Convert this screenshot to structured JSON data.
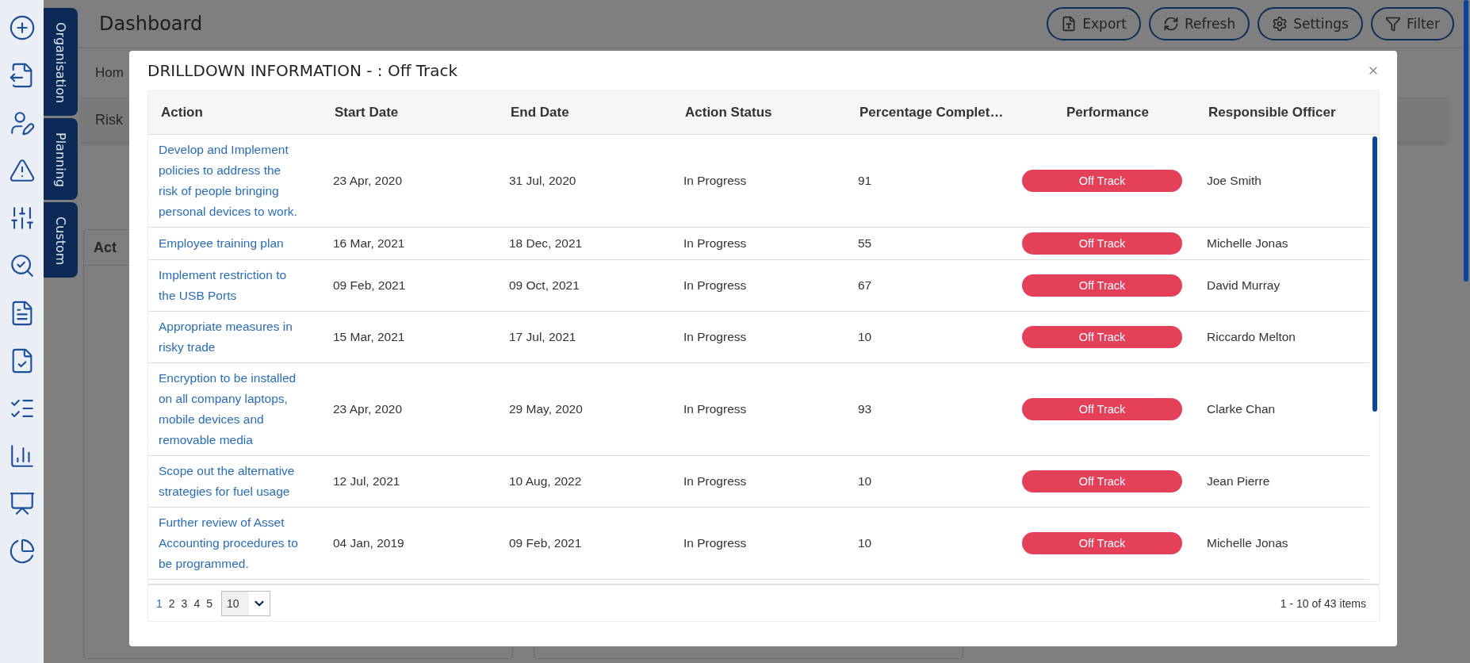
{
  "side_tabs": [
    {
      "label": "Organisation"
    },
    {
      "label": "Planning"
    },
    {
      "label": "Custom"
    }
  ],
  "header": {
    "title": "Dashboard",
    "buttons": [
      {
        "kind": "export",
        "label": "Export"
      },
      {
        "kind": "refresh",
        "label": "Refresh"
      },
      {
        "kind": "settings",
        "label": "Settings"
      },
      {
        "kind": "filter",
        "label": "Filter"
      }
    ]
  },
  "background": {
    "breadcrumb": "Hom",
    "section": "Risk",
    "panel_title": "Act"
  },
  "modal": {
    "title": "DRILLDOWN INFORMATION - : Off Track",
    "table": {
      "columns": [
        "Action",
        "Start Date",
        "End Date",
        "Action Status",
        "Percentage Complet…",
        "Performance",
        "Responsible Officer"
      ],
      "rows": [
        {
          "action": "Develop and Implement policies to address the risk of people bringing personal devices to work.",
          "start": "23 Apr, 2020",
          "end": "31 Jul, 2020",
          "status": "In Progress",
          "percent": "91",
          "performance": "Off Track",
          "officer": "Joe Smith"
        },
        {
          "action": "Employee training plan",
          "start": "16 Mar, 2021",
          "end": "18 Dec, 2021",
          "status": "In Progress",
          "percent": "55",
          "performance": "Off Track",
          "officer": "Michelle Jonas"
        },
        {
          "action": "Implement restriction to the USB Ports",
          "start": "09 Feb, 2021",
          "end": "09 Oct, 2021",
          "status": "In Progress",
          "percent": "67",
          "performance": "Off Track",
          "officer": "David Murray"
        },
        {
          "action": "Appropriate measures in risky trade",
          "start": "15 Mar, 2021",
          "end": "17 Jul, 2021",
          "status": "In Progress",
          "percent": "10",
          "performance": "Off Track",
          "officer": "Riccardo Melton"
        },
        {
          "action": "Encryption to be installed on all company laptops, mobile devices and removable media",
          "start": "23 Apr, 2020",
          "end": "29 May, 2020",
          "status": "In Progress",
          "percent": "93",
          "performance": "Off Track",
          "officer": "Clarke Chan"
        },
        {
          "action": "Scope out the alternative strategies for fuel usage",
          "start": "12 Jul, 2021",
          "end": "10 Aug, 2022",
          "status": "In Progress",
          "percent": "10",
          "performance": "Off Track",
          "officer": "Jean Pierre"
        },
        {
          "action": "Further review of Asset Accounting procedures to be programmed.",
          "start": "04 Jan, 2019",
          "end": "09 Feb, 2021",
          "status": "In Progress",
          "percent": "10",
          "performance": "Off Track",
          "officer": "Michelle Jonas"
        }
      ]
    },
    "pager": {
      "pages": [
        {
          "label": "1",
          "selected": true
        },
        {
          "label": "2",
          "selected": false
        },
        {
          "label": "3",
          "selected": false
        },
        {
          "label": "4",
          "selected": false
        },
        {
          "label": "5",
          "selected": false
        }
      ],
      "page_size": "10",
      "info": "1 - 10 of 43 items"
    }
  }
}
